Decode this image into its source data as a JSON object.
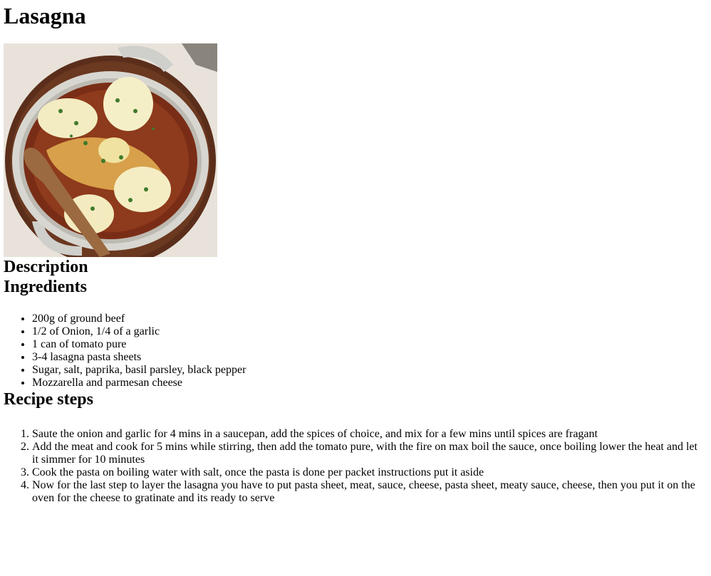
{
  "title": "Lasagna",
  "image": {
    "alt": "lasagna in a skillet"
  },
  "description_heading": "Description",
  "ingredients_heading": "Ingredients",
  "ingredients": [
    "200g of ground beef",
    "1/2 of Onion, 1/4 of a garlic",
    "1 can of tomato pure",
    "3-4 lasagna pasta sheets",
    "Sugar, salt, paprika, basil parsley, black pepper",
    "Mozzarella and parmesan cheese"
  ],
  "steps_heading": "Recipe steps",
  "steps": [
    "Saute the onion and garlic for 4 mins in a saucepan, add the spices of choice, and mix for a few mins until spices are fragant",
    "Add the meat and cook for 5 mins while stirring, then add the tomato pure, with the fire on max boil the sauce, once boiling lower the heat and let it simmer for 10 minutes",
    "Cook the pasta on boiling water with salt, once the pasta is done per packet instructions put it aside",
    "Now for the last step to layer the lasagna you have to put pasta sheet, meat, sauce, cheese, pasta sheet, meaty sauce, cheese, then you put it on the oven for the cheese to gratinate and its ready to serve"
  ]
}
